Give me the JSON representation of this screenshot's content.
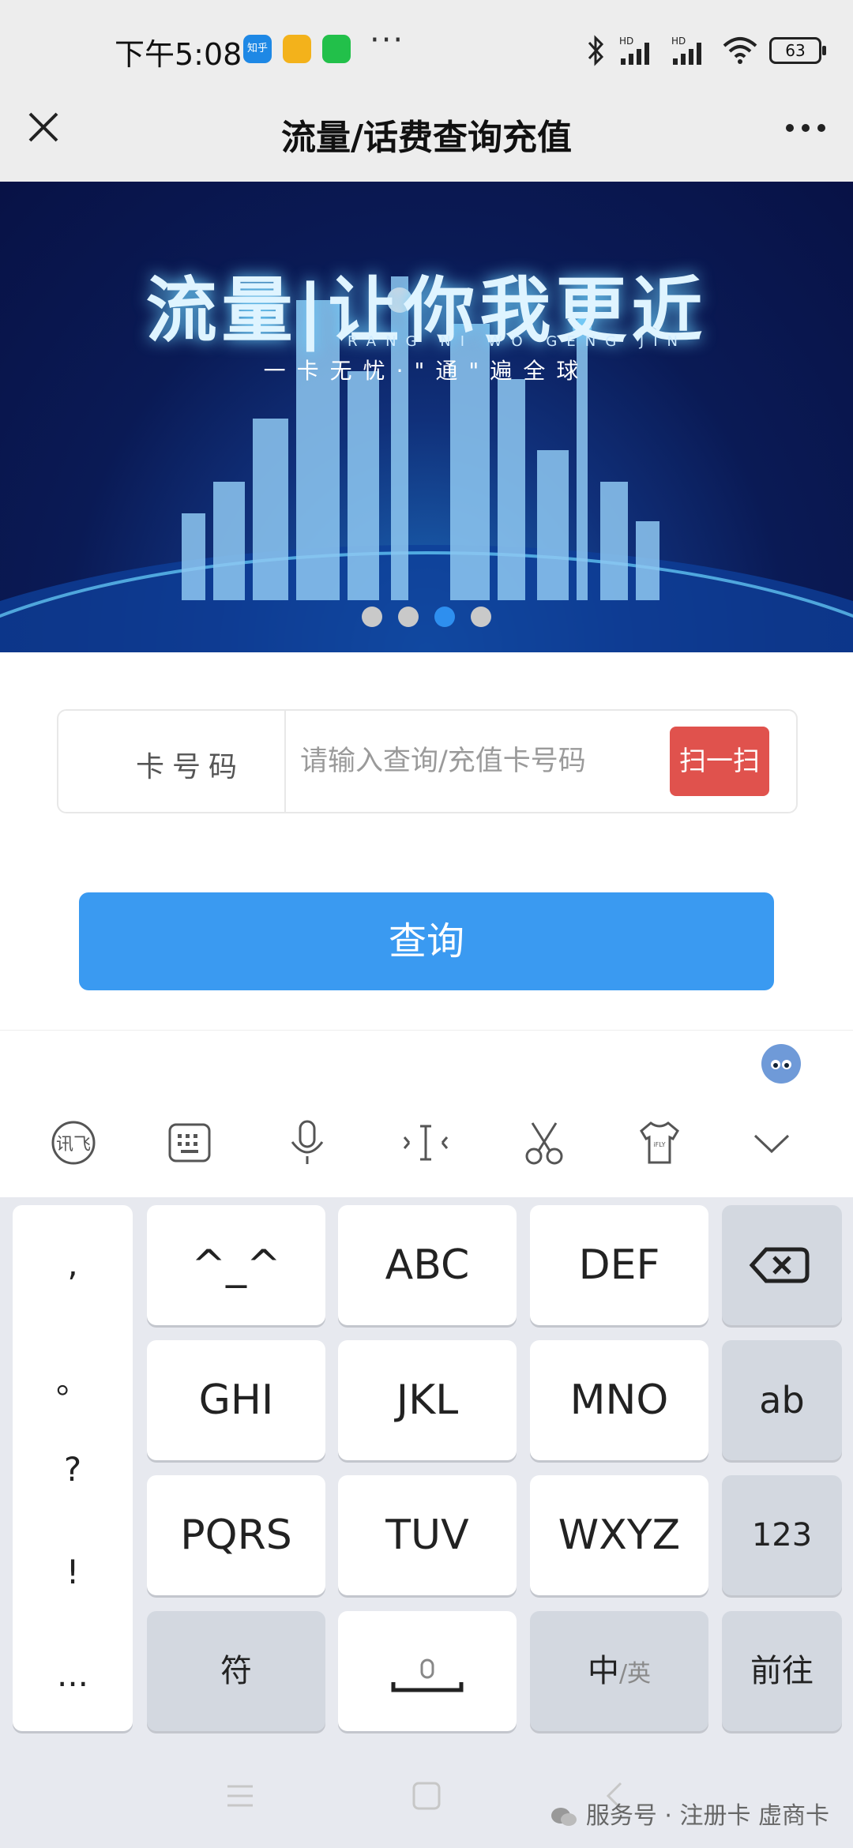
{
  "status_bar": {
    "time": "下午5:08",
    "apps": [
      {
        "label": "知乎",
        "color": "#1e88e5"
      },
      {
        "label": "",
        "color": "#f3b21b"
      },
      {
        "label": "",
        "color": "#22c04a"
      }
    ],
    "more": "···",
    "network_badges": [
      "HD",
      "HD"
    ],
    "battery": "63"
  },
  "header": {
    "title": "流量/话费查询充值"
  },
  "banner": {
    "headline": "流量|让你我更近",
    "subtitle_en": "RANG NI WO GENG JIN",
    "slogan": "一卡无忧·\"通\"遍全球",
    "active_slide": 3,
    "total_slides": 4
  },
  "form": {
    "card_label": "卡号码",
    "card_placeholder": "请输入查询/充值卡号码",
    "card_value": "",
    "scan_label": "扫一扫",
    "query_label": "查询"
  },
  "keyboard": {
    "toolbar_icons": [
      "ifly-logo-icon",
      "keyboard-icon",
      "microphone-icon",
      "cursor-icon",
      "scissors-icon",
      "shirt-icon",
      "chevron-down-icon"
    ],
    "punctuation": [
      ",",
      "。",
      "?",
      "!",
      "..."
    ],
    "rows": [
      [
        "^_^",
        "ABC",
        "DEF"
      ],
      [
        "GHI",
        "JKL",
        "MNO"
      ],
      [
        "PQRS",
        "TUV",
        "WXYZ"
      ]
    ],
    "side_keys": {
      "backspace": "",
      "ab": "ab",
      "num": "123"
    },
    "bottom": {
      "symbols": "符",
      "lang_main": "中",
      "lang_alt": "/英",
      "enter": "前往"
    }
  },
  "watermark": "服务号 · 注册卡 虚商卡",
  "colors": {
    "accent": "#3a9af1",
    "scan": "#e0524d",
    "banner_dark": "#081246"
  }
}
